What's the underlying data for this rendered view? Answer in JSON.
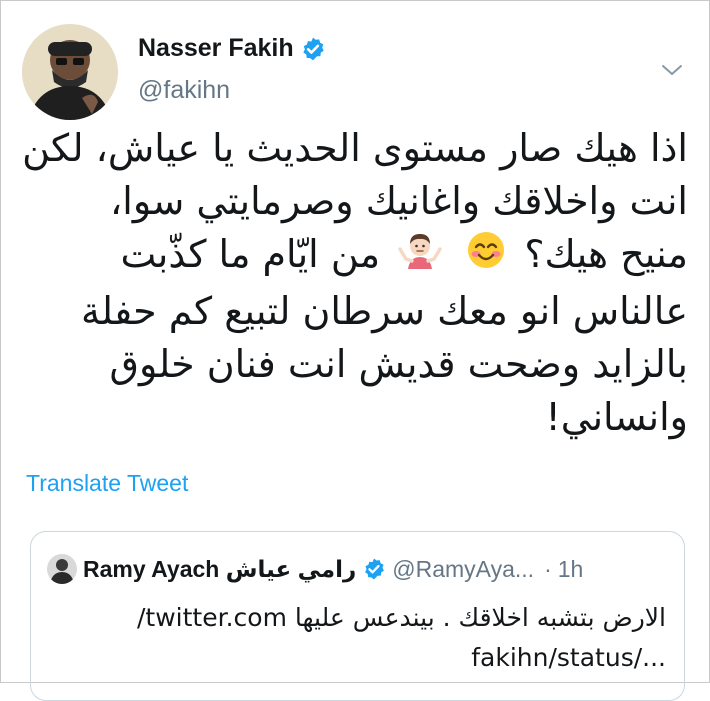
{
  "author": {
    "display_name": "Nasser Fakih",
    "handle": "@fakihn",
    "avatar_icon": "profile-photo",
    "verified": true
  },
  "tweet": {
    "lines": [
      "اذا هيك صار مستوى الحديث يا عياش، لكن",
      "انت واخلاقك واغانيك وصرمايتي سوا،",
      "منيح هيك؟",
      "من ايّام ما كذّبت",
      "عالناس انو معك سرطان لتبيع كم حفلة",
      "بالزايد وضحت قديش انت فنان خلوق",
      "وانساني!"
    ],
    "emojis": [
      "smiling-face-with-smiling-eyes-emoji",
      "person-shrugging-emoji"
    ]
  },
  "translate_label": "Translate Tweet",
  "quoted": {
    "display_name": "Ramy Ayach رامي عياش",
    "handle": "@RamyAya...",
    "separator": "·",
    "time": "1h",
    "verified": true,
    "text_line1": "الارض بتشبه اخلاقك . بيندعس عليها twitter.com/",
    "text_line2": ".../fakihn/status"
  },
  "colors": {
    "link": "#1da1f2",
    "secondary_text": "#657786",
    "verified": "#1da1f2",
    "border": "#ccd6dd"
  }
}
